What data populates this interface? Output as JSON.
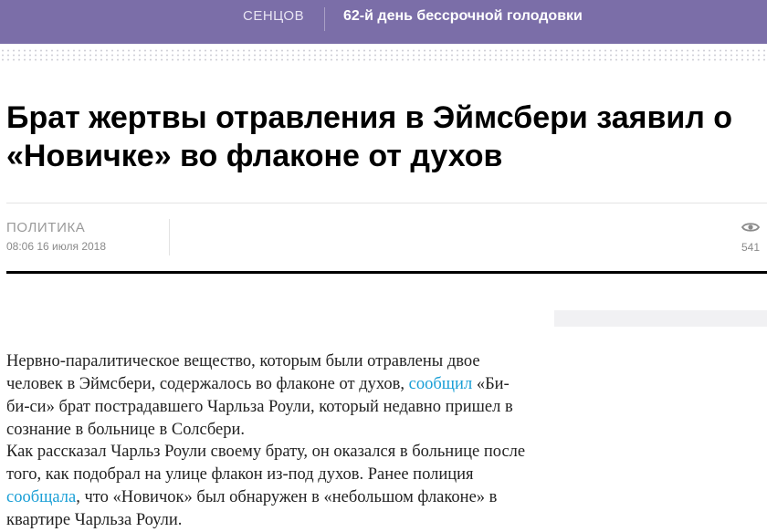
{
  "topbar": {
    "tag": "СЕНЦОВ",
    "headline": "62-й день бессрочной голодовки"
  },
  "article": {
    "title_line1": "Брат жертвы отравления в Эймсбери заявил о",
    "title_line2": "«Новичке» во флаконе от духов",
    "rubric": "ПОЛИТИКА",
    "date": "08:06 16 июля 2018",
    "views": "541",
    "paragraphs": [
      {
        "before": "Нервно-паралитическое вещество, которым были отравлены двое человек в Эймсбери, содержалось во флаконе от духов, ",
        "link": "сообщил",
        "after": " «Би-би-си» брат пострадавшего Чарльза Роули, который недавно пришел в сознание в больнице в Солсбери."
      },
      {
        "before": "Как рассказал Чарльз Роули своему брату, он оказался в больнице после того, как подобрал на улице флакон из-под духов. Ранее полиция ",
        "link": "сообщала",
        "after": ", что «Новичок» был обнаружен в «небольшом флаконе» в квартире Чарльза Роули."
      }
    ]
  },
  "colors": {
    "topbar_bg": "#7b6ea8",
    "link": "#1a9fd6"
  },
  "icons": {
    "views": "eye-icon"
  }
}
